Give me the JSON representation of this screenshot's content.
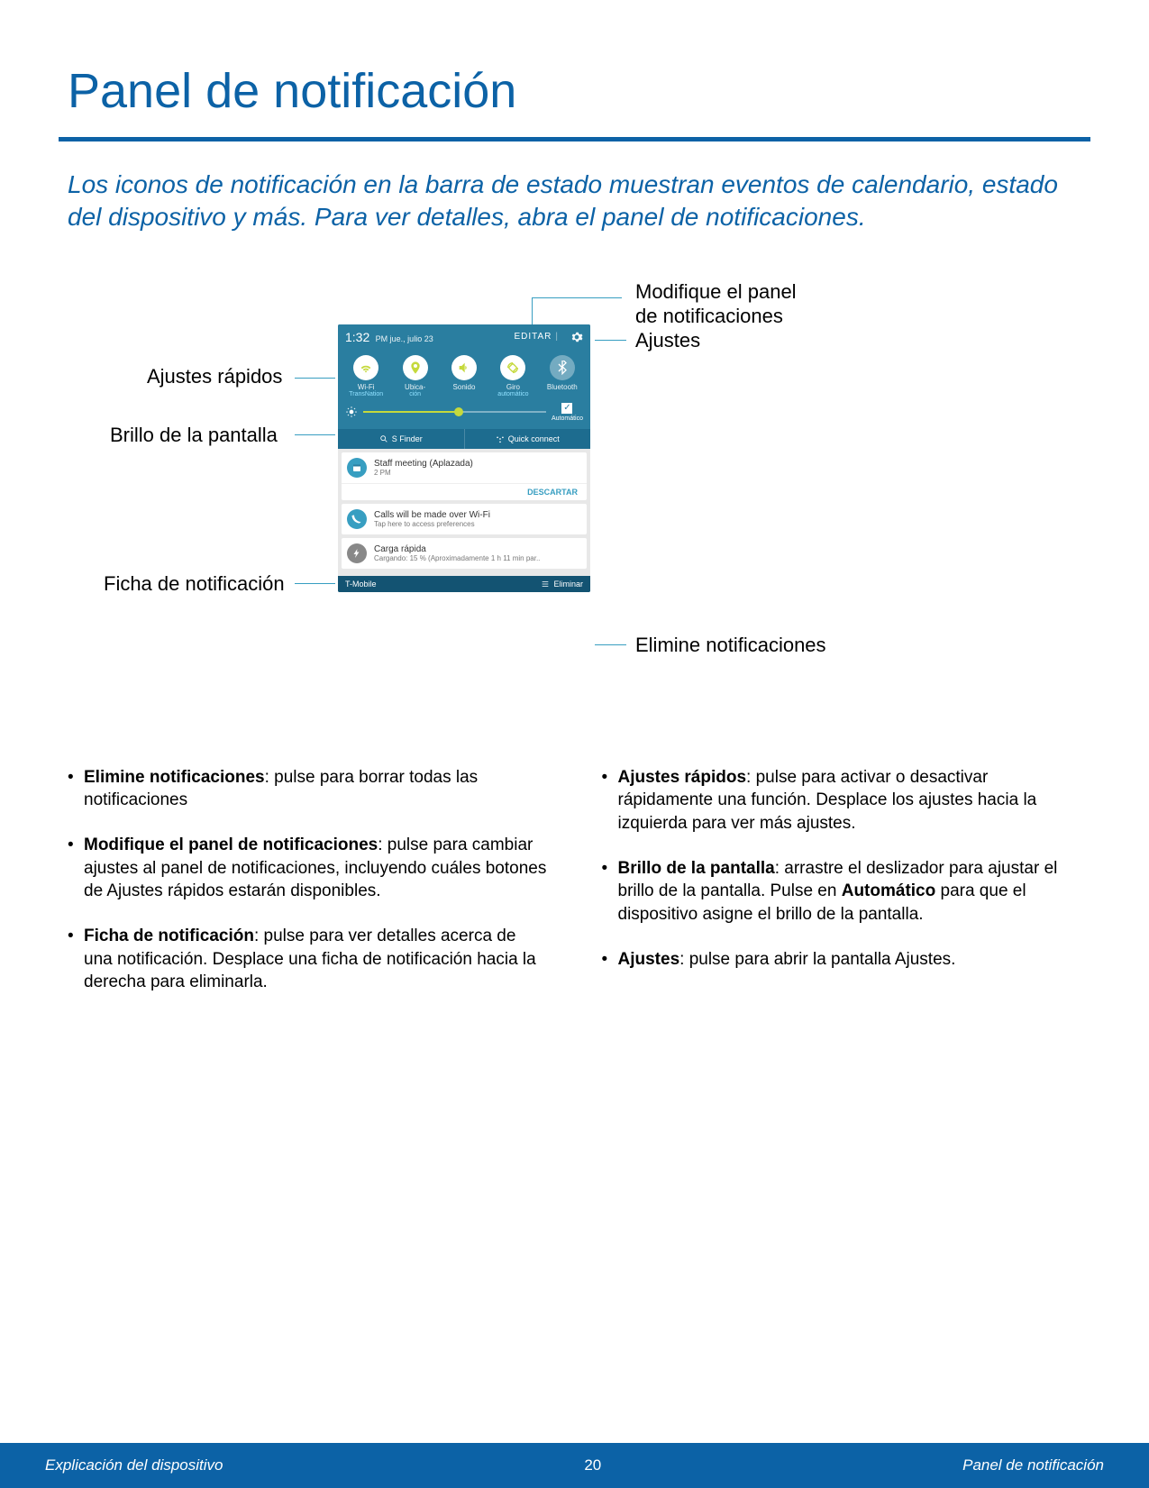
{
  "title": "Panel de notificación",
  "intro": "Los iconos de notificación en la barra de estado muestran eventos de calendario, estado del dispositivo y más. Para ver detalles, abra el panel de notificaciones.",
  "phone": {
    "time": "1:32",
    "ampm": "PM",
    "date": "jue., julio 23",
    "edit": "EDITAR",
    "qs": [
      {
        "label": "Wi-Fi",
        "sub": "TransNation"
      },
      {
        "label": "Ubica-",
        "sub": "ción"
      },
      {
        "label": "Sonido",
        "sub": ""
      },
      {
        "label": "Giro",
        "sub": "automático"
      },
      {
        "label": "Bluetooth",
        "sub": ""
      }
    ],
    "auto": "Automático",
    "sfinder": "S Finder",
    "quick": "Quick connect",
    "notif1_title": "Staff meeting (Aplazada)",
    "notif1_sub": "2 PM",
    "discard": "DESCARTAR",
    "notif2_title": "Calls will be made over Wi-Fi",
    "notif2_sub": "Tap here to access preferences",
    "notif3_title": "Carga rápida",
    "notif3_sub": "Cargando: 15 % (Aproximadamente 1 h 11 min par..",
    "carrier": "T-Mobile",
    "clear": "Eliminar"
  },
  "labels": {
    "quick_settings": "Ajustes rápidos",
    "brightness": "Brillo de la pantalla",
    "notif_tile": "Ficha de notificación",
    "edit_panel1": "Modifique el panel",
    "edit_panel2": "de notificaciones",
    "settings": "Ajustes",
    "clear_notifs": "Elimine notificaciones"
  },
  "bullets_left": [
    {
      "b": "Elimine notificaciones",
      "t": ": pulse para borrar todas las notificaciones"
    },
    {
      "b": "Modifique el panel de notificaciones",
      "t": ": pulse para cambiar ajustes al panel de notificaciones, incluyendo cuáles botones de Ajustes rápidos estarán disponibles."
    },
    {
      "b": "Ficha de notificación",
      "t": ": pulse para ver detalles acerca de una notificación. Desplace una ficha de notificación hacia la derecha para eliminarla."
    }
  ],
  "bullets_right": [
    {
      "b": "Ajustes rápidos",
      "t": ": pulse para activar o desactivar rápidamente una función. Desplace los ajustes hacia la izquierda para ver más ajustes."
    },
    {
      "b": "Brillo de la pantalla",
      "t": ": arrastre el deslizador para ajustar el brillo de la pantalla. Pulse en ",
      "b2": "Automático",
      "t2": " para que el dispositivo asigne el brillo de la pantalla."
    },
    {
      "b": "Ajustes",
      "t": ": pulse para abrir la pantalla Ajustes."
    }
  ],
  "footer": {
    "left": "Explicación del dispositivo",
    "center": "20",
    "right": "Panel de notificación"
  }
}
